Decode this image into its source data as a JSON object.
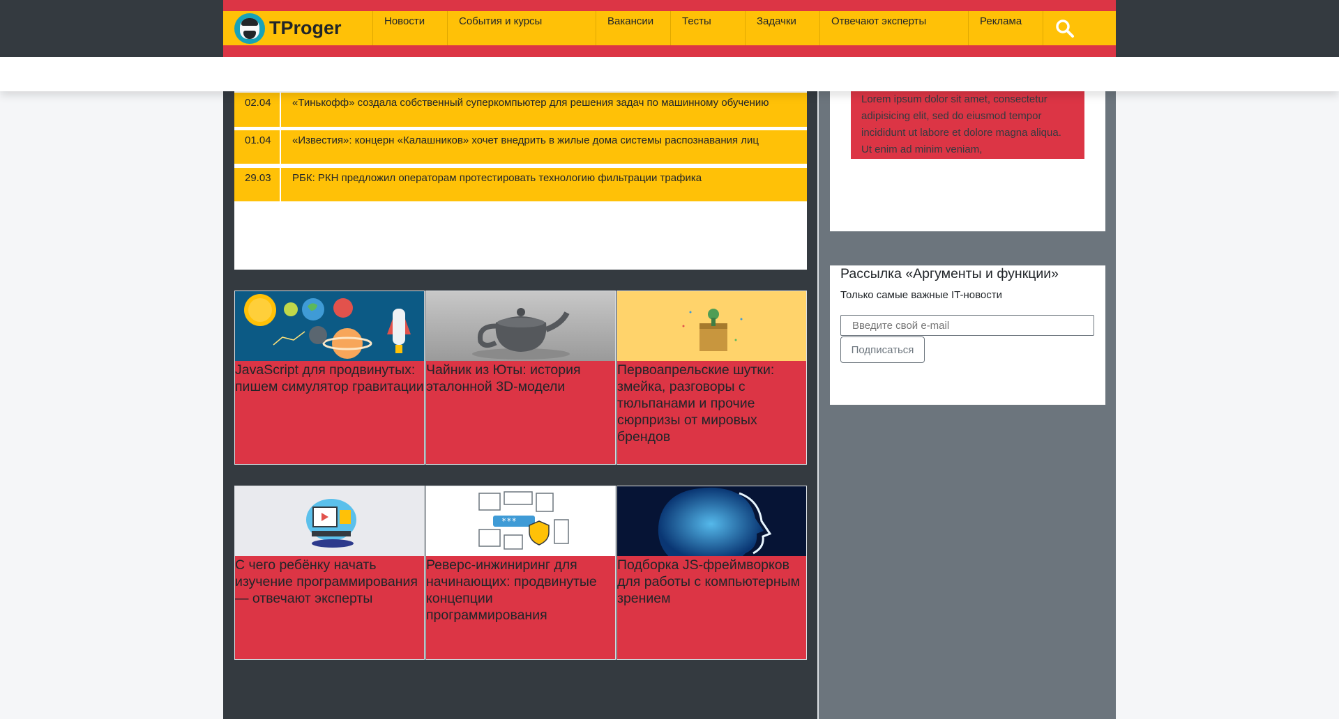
{
  "header": {
    "logo_text": "TProger",
    "nav": [
      "Новости",
      "События и курсы",
      "Вакансии",
      "Тесты",
      "Задачки",
      "Отвечают эксперты",
      "Реклама"
    ]
  },
  "news": [
    {
      "date": "02.04",
      "title": "«Тинькофф» создала собственный суперкомпьютер для решения задач по машинному обучению"
    },
    {
      "date": "01.04",
      "title": "«Известия»: концерн «Калашников» хочет внедрить в жилые дома системы распознавания лиц"
    },
    {
      "date": "29.03",
      "title": "РБК: РКН предложил операторам протестировать технологию фильтрации трафика"
    }
  ],
  "cards_row1": [
    {
      "title": "JavaScript для продвинутых: пишем симулятор гравитации"
    },
    {
      "title": "Чайник из Юты: история эталонной 3D-модели"
    },
    {
      "title": "Первоапрельские шутки: змейка, разговоры с тюльпанами и прочие сюрпризы от мировых брендов"
    }
  ],
  "cards_row2": [
    {
      "title": "С чего ребёнку начать изучение программирования — отвечают эксперты"
    },
    {
      "title": "Реверс-инжиниринг для начинающих: продвинутые концепции программирования"
    },
    {
      "title": "Подборка JS-фреймворков для работы с компьютерным зрением"
    }
  ],
  "sidebar": {
    "lorem": "Lorem ipsum dolor sit amet, consectetur adipisicing elit, sed do eiusmod tempor incididunt ut labore et dolore magna aliqua. Ut enim ad minim veniam,",
    "newsletter": {
      "title": "Рассылка «Аргументы и функции»",
      "subtitle": "Только самые важные IT-новости",
      "email_placeholder": "Введите свой e-mail",
      "button": "Подписаться"
    }
  },
  "colors": {
    "nav_bg": "#ffc107",
    "accent_red": "#dc3545",
    "dark": "#343a40",
    "sidebar": "#6c757d"
  }
}
